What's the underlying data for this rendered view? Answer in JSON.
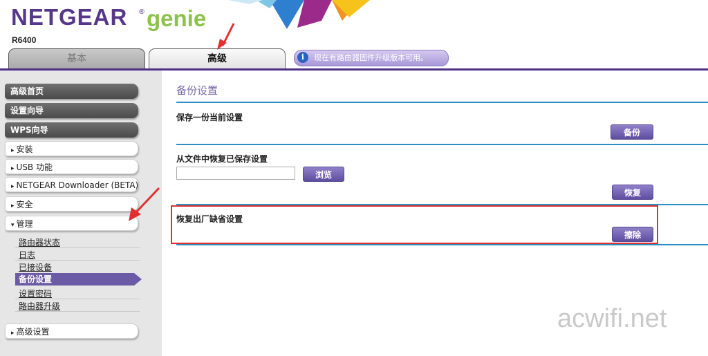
{
  "header": {
    "brand": "NETGEAR",
    "reg_mark": "®",
    "product": "genie",
    "model": "R6400",
    "tabs": [
      {
        "label": "基本",
        "active": false
      },
      {
        "label": "高级",
        "active": true
      }
    ],
    "notice": "现在有路由器固件升级版本可用。",
    "notice_icon": "info-icon"
  },
  "sidebar": {
    "top_buttons": [
      "高级首页",
      "设置向导",
      "WPS向导"
    ],
    "menu_items": [
      "安装",
      "USB 功能",
      "NETGEAR Downloader (BETA)",
      "安全"
    ],
    "expanded_menu": "管理",
    "submenu": [
      "路由器状态",
      "日志",
      "已接设备",
      "备份设置",
      "设置密码",
      "路由器升级"
    ],
    "active_submenu": "备份设置",
    "bottom_item": "高级设置",
    "expand_glyph": "▸",
    "collapse_glyph": "▾"
  },
  "content": {
    "title": "备份设置",
    "backup": {
      "label": "保存一份当前设置",
      "button": "备份"
    },
    "restore": {
      "label": "从文件中恢复已保存设置",
      "file_value": "",
      "browse_button": "浏览",
      "button": "恢复"
    },
    "factory": {
      "label": "恢复出厂缺省设置",
      "button": "擦除"
    }
  },
  "colors": {
    "brand_purple": "#56378a",
    "genie_green": "#8bc34a",
    "accent_purple": "#6b5aa5",
    "divider_blue": "#2b8fc4",
    "highlight_red": "#e03030"
  },
  "watermark": "acwifi.net"
}
